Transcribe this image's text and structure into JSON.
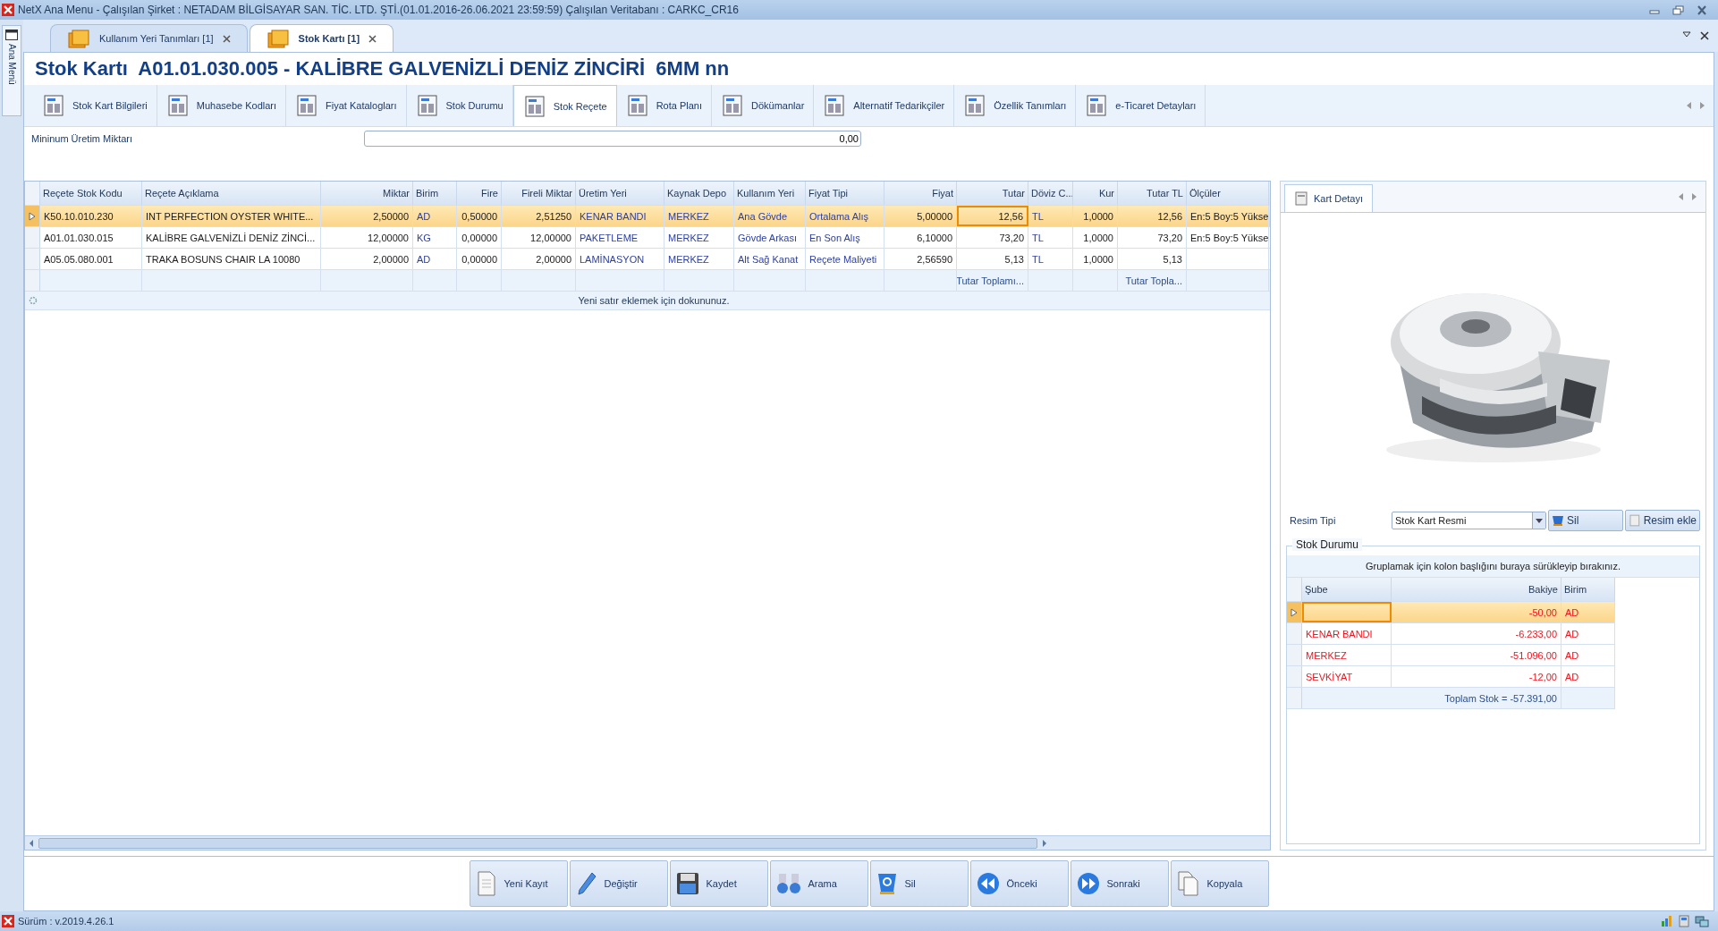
{
  "window": {
    "title": "NetX Ana Menu - Çalışılan Şirket : NETADAM BİLGİSAYAR SAN. TİC. LTD. ŞTİ.(01.01.2016-26.06.2021 23:59:59) Çalışılan Veritabanı : CARKC_CR16"
  },
  "side_panel": {
    "label": "Ana Menü"
  },
  "document_tabs": [
    {
      "label": "Kullanım Yeri Tanımları [1]",
      "selected": false
    },
    {
      "label": "Stok Kartı [1]",
      "selected": true
    }
  ],
  "heading": "Stok Kartı  A01.01.030.005 - KALİBRE GALVENİZLİ DENİZ ZİNCİRİ  6MM nn",
  "section_tabs": [
    {
      "label": "Stok Kart Bilgileri",
      "selected": false
    },
    {
      "label": "Muhasebe Kodları",
      "selected": false
    },
    {
      "label": "Fiyat Katalogları",
      "selected": false
    },
    {
      "label": "Stok Durumu",
      "selected": false
    },
    {
      "label": "Stok Reçete",
      "selected": true
    },
    {
      "label": "Rota Planı",
      "selected": false
    },
    {
      "label": "Dökümanlar",
      "selected": false
    },
    {
      "label": "Alternatif Tedarikçiler",
      "selected": false
    },
    {
      "label": "Özellik Tanımları",
      "selected": false
    },
    {
      "label": "e-Ticaret Detayları",
      "selected": false
    }
  ],
  "min_production": {
    "label": "Mininum Üretim Miktarı",
    "value": "0,00"
  },
  "recipe_table": {
    "columns": [
      {
        "label": "Reçete Stok Kodu",
        "kind": "text",
        "focused": false
      },
      {
        "label": "Reçete Açıklama",
        "kind": "text",
        "focused": false
      },
      {
        "label": "Miktar",
        "kind": "number",
        "focused": false
      },
      {
        "label": "Birim",
        "kind": "lookup",
        "focused": false
      },
      {
        "label": "Fire",
        "kind": "number",
        "focused": false
      },
      {
        "label": "Fireli Miktar",
        "kind": "number",
        "focused": false
      },
      {
        "label": "Üretim Yeri",
        "kind": "lookup",
        "focused": false
      },
      {
        "label": "Kaynak Depo",
        "kind": "lookup",
        "focused": false
      },
      {
        "label": "Kullanım Yeri",
        "kind": "lookup",
        "focused": false
      },
      {
        "label": "Fiyat Tipi",
        "kind": "lookup",
        "focused": false
      },
      {
        "label": "Fiyat",
        "kind": "number",
        "focused": false
      },
      {
        "label": "Tutar",
        "kind": "number",
        "focused": true,
        "summary": "Tutar Toplamı..."
      },
      {
        "label": "Döviz C...",
        "kind": "lookup",
        "focused": false
      },
      {
        "label": "Kur",
        "kind": "number",
        "focused": false
      },
      {
        "label": "Tutar TL",
        "kind": "number",
        "focused": false,
        "summary": "Tutar Topla..."
      },
      {
        "label": "Ölçüler",
        "kind": "text",
        "focused": false
      }
    ],
    "rows": [
      {
        "selected": true,
        "cells": [
          "K50.10.010.230",
          "INT PERFECTION OYSTER WHITE...",
          "2,50000",
          "AD",
          "0,50000",
          "2,51250",
          "KENAR BANDI",
          "MERKEZ",
          "Ana Gövde",
          "Ortalama Alış",
          "5,00000",
          "12,56",
          "TL",
          "1,0000",
          "12,56",
          "En:5 Boy:5 Yükse"
        ]
      },
      {
        "selected": false,
        "cells": [
          "A01.01.030.015",
          "KALİBRE GALVENİZLİ DENİZ ZİNCİ...",
          "12,00000",
          "KG",
          "0,00000",
          "12,00000",
          "PAKETLEME",
          "MERKEZ",
          "Gövde Arkası",
          "En Son Alış",
          "6,10000",
          "73,20",
          "TL",
          "1,0000",
          "73,20",
          "En:5 Boy:5 Yükse"
        ]
      },
      {
        "selected": false,
        "cells": [
          "A05.05.080.001",
          "TRAKA BOSUNS CHAIR  LA 10080",
          "2,00000",
          "AD",
          "0,00000",
          "2,00000",
          "LAMİNASYON",
          "MERKEZ",
          "Alt Sağ Kanat",
          "Reçete Maliyeti",
          "2,56590",
          "5,13",
          "TL",
          "1,0000",
          "5,13"
        ]
      }
    ],
    "new_row_hint": "Yeni satır eklemek için dokununuz."
  },
  "detail_panel": {
    "tab": "Kart Detayı",
    "image": {
      "kind": "picture"
    },
    "image_type": {
      "label": "Resim Tipi",
      "value": "Stok Kart Resmi"
    },
    "buttons": [
      "Sil",
      "Resim ekle"
    ],
    "stock_status": {
      "title": "Stok Durumu",
      "group_hint": "Gruplamak için kolon başlığını buraya sürükleyip bırakınız.",
      "columns": [
        {
          "label": "Şube",
          "focused": true
        },
        {
          "label": "Bakiye",
          "focused": false
        },
        {
          "label": "Birim",
          "focused": false
        }
      ],
      "rows": [
        {
          "selected": true,
          "balance": "-50,00",
          "unit": "AD"
        },
        {
          "selected": false,
          "branch": "KENAR BANDI",
          "balance": "-6.233,00",
          "unit": "AD"
        },
        {
          "selected": false,
          "branch": "MERKEZ",
          "balance": "-51.096,00",
          "unit": "AD"
        },
        {
          "selected": false,
          "branch": "SEVKİYAT",
          "balance": "-12,00",
          "unit": "AD"
        }
      ],
      "total": "Toplam Stok = -57.391,00"
    }
  },
  "actions": [
    {
      "label": "Yeni Kayıt",
      "kind": "new"
    },
    {
      "label": "Değiştir",
      "kind": "edit"
    },
    {
      "label": "Kaydet",
      "kind": "save"
    },
    {
      "label": "Arama",
      "kind": "search"
    },
    {
      "label": "Sil",
      "kind": "delete"
    },
    {
      "label": "Önceki",
      "kind": "previous"
    },
    {
      "label": "Sonraki",
      "kind": "next"
    },
    {
      "label": "Kopyala",
      "kind": "copy"
    }
  ],
  "status_bar": {
    "version": "Sürüm : v.2019.4.26.1"
  }
}
